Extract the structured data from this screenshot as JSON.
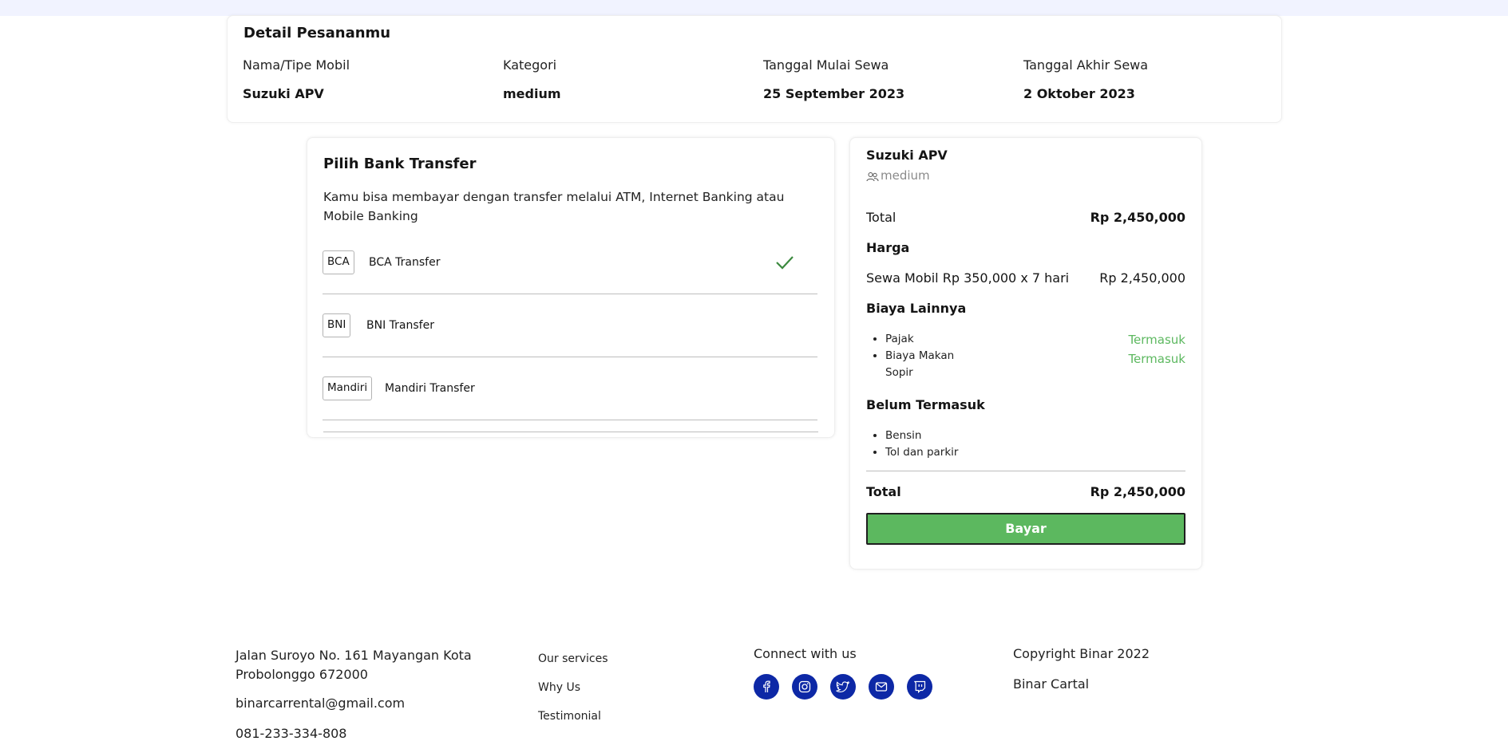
{
  "detail": {
    "title": "Detail Pesananmu",
    "columns": [
      {
        "label": "Nama/Tipe Mobil",
        "value": "Suzuki APV"
      },
      {
        "label": "Kategori",
        "value": "medium"
      },
      {
        "label": "Tanggal Mulai Sewa",
        "value": "25 September 2023"
      },
      {
        "label": "Tanggal Akhir Sewa",
        "value": "2 Oktober 2023"
      }
    ]
  },
  "bank": {
    "title": "Pilih Bank Transfer",
    "description": "Kamu bisa membayar dengan transfer melalui ATM, Internet Banking atau Mobile Banking",
    "selected": "BCA",
    "options": [
      {
        "code": "BCA",
        "name": "BCA Transfer"
      },
      {
        "code": "BNI",
        "name": "BNI Transfer"
      },
      {
        "code": "Mandiri",
        "name": "Mandiri Transfer"
      }
    ],
    "selected_icon": "check-icon"
  },
  "summary": {
    "car_name": "Suzuki APV",
    "category": "medium",
    "category_icon": "users-icon",
    "total_label": "Total",
    "total_value": "Rp 2,450,000",
    "price_title": "Harga",
    "rent_label": "Sewa Mobil Rp 350,000 x 7 hari",
    "rent_value": "Rp 2,450,000",
    "other_title": "Biaya Lainnya",
    "other_items": [
      "Pajak",
      "Biaya Makan Sopir"
    ],
    "other_status": [
      "Termasuk",
      "Termasuk"
    ],
    "excluded_title": "Belum Termasuk",
    "excluded_items": [
      "Bensin",
      "Tol dan parkir"
    ],
    "grand_total_label": "Total",
    "grand_total_value": "Rp 2,450,000",
    "pay_button": "Bayar"
  },
  "footer": {
    "address": "Jalan Suroyo No. 161 Mayangan Kota Probolonggo 672000",
    "email": "binarcarrental@gmail.com",
    "phone": "081-233-334-808",
    "links": [
      "Our services",
      "Why Us",
      "Testimonial"
    ],
    "connect_title": "Connect with us",
    "social_icons": [
      "facebook-icon",
      "instagram-icon",
      "twitter-icon",
      "mail-icon",
      "twitch-icon"
    ],
    "copyright": "Copyright Binar 2022",
    "brand": "Binar Cartal"
  },
  "colors": {
    "accent_green": "#5cb85f",
    "social_blue": "#0d28a6",
    "top_band": "#f1f3ff"
  }
}
